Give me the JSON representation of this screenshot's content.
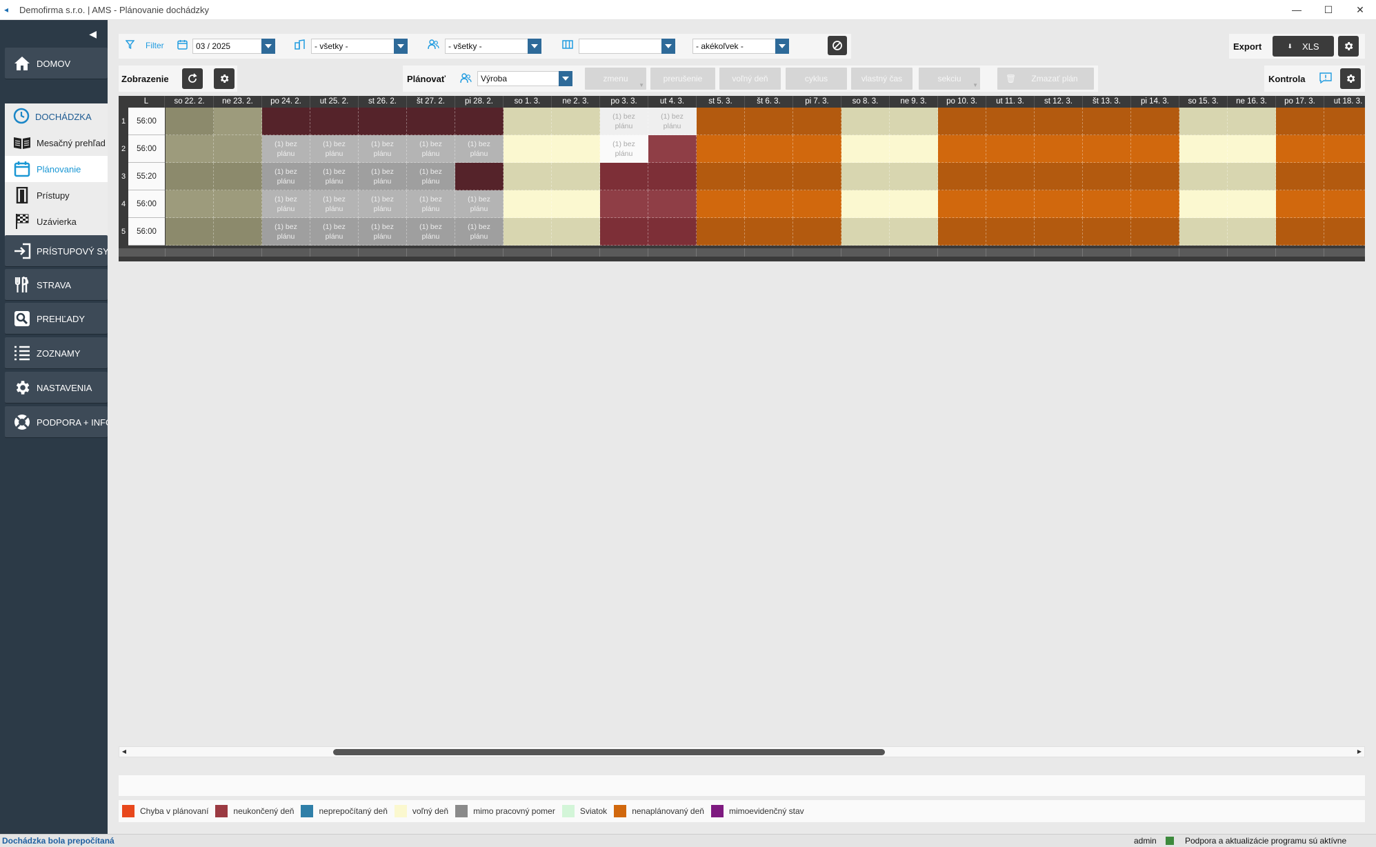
{
  "window": {
    "title": "Demofirma s.r.o. | AMS - Plánovanie dochádzky",
    "controls": [
      "—",
      "☐",
      "✕"
    ]
  },
  "sidebar": {
    "main_items": [
      {
        "label": "DOMOV",
        "icon": "home-icon"
      },
      {
        "label": "PRÍSTUPOVÝ SYSTÉM",
        "icon": "login-icon"
      },
      {
        "label": "STRAVA",
        "icon": "cutlery-icon"
      },
      {
        "label": "PREHĽADY",
        "icon": "search-icon"
      },
      {
        "label": "ZOZNAMY",
        "icon": "list-icon"
      },
      {
        "label": "NASTAVENIA",
        "icon": "gear-icon"
      },
      {
        "label": "PODPORA + INFO",
        "icon": "lifebuoy-icon"
      }
    ],
    "section": {
      "header": "DOCHÁDZKA",
      "items": [
        {
          "label": "Mesačný prehľad",
          "icon": "book-icon",
          "active": false
        },
        {
          "label": "Plánovanie",
          "icon": "calendar-icon",
          "active": true
        },
        {
          "label": "Prístupy",
          "icon": "door-icon",
          "active": false
        },
        {
          "label": "Uzávierka",
          "icon": "flag-icon",
          "active": false
        }
      ]
    }
  },
  "filter": {
    "label": "Filter",
    "month": "03 / 2025",
    "department": "- všetky -",
    "group": "- všetky -",
    "column_select": "",
    "any_select": "- akékoľvek -"
  },
  "export": {
    "label": "Export",
    "xls_label": "XLS"
  },
  "display": {
    "label": "Zobrazenie"
  },
  "plan": {
    "label": "Plánovať",
    "selected": "Výroba",
    "buttons": [
      "zmenu",
      "prerušenie",
      "voľný deň",
      "cyklus",
      "vlastný čas",
      "sekciu"
    ],
    "delete_label": "Zmazať plán"
  },
  "control": {
    "label": "Kontrola"
  },
  "grid": {
    "total_header": "L",
    "days": [
      "so 22. 2.",
      "ne 23. 2.",
      "po 24. 2.",
      "ut 25. 2.",
      "st 26. 2.",
      "št 27. 2.",
      "pi 28. 2.",
      "so 1. 3.",
      "ne 2. 3.",
      "po 3. 3.",
      "ut 4. 3.",
      "st 5. 3.",
      "št 6. 3.",
      "pi 7. 3.",
      "so 8. 3.",
      "ne 9. 3.",
      "po 10. 3.",
      "ut 11. 3.",
      "st 12. 3.",
      "št 13. 3.",
      "pi 14. 3.",
      "so 15. 3.",
      "ne 16. 3.",
      "po 17. 3.",
      "ut 18. 3."
    ],
    "rows": [
      {
        "num": "1",
        "total": "56:00"
      },
      {
        "num": "2",
        "total": "56:00"
      },
      {
        "num": "3",
        "total": "55:20"
      },
      {
        "num": "4",
        "total": "56:00"
      },
      {
        "num": "5",
        "total": "56:00"
      }
    ],
    "cell_text": "(1) bez plánu",
    "colors": {
      "A": "#8c8a6c",
      "B": "#9d9b7c",
      "D": "#55232a",
      "G": "#9f9f9f",
      "Gs": "#b4b4b4",
      "Y": "#d8d6b0",
      "Yl": "#fbf8d0",
      "R": "#7d2f37",
      "Rl": "#8f3e46",
      "W": "#efefef",
      "Ww": "#fafafa",
      "O": "#b35a0f",
      "Ol": "#d1680d"
    },
    "cells": [
      [
        "A",
        "B",
        "D",
        "D",
        "D",
        "D",
        "D",
        "Y",
        "Y",
        "Wg",
        "Wg",
        "O",
        "O",
        "O",
        "Y",
        "Y",
        "O",
        "O",
        "O",
        "O",
        "O",
        "Y",
        "Y",
        "O",
        "O"
      ],
      [
        "B",
        "B",
        "Gt",
        "Gt",
        "Gt",
        "Gt",
        "Gt",
        "Yl",
        "Yl",
        "Wt",
        "Rl",
        "Ol",
        "Ol",
        "Ol",
        "Yl",
        "Yl",
        "Ol",
        "Ol",
        "Ol",
        "Ol",
        "Ol",
        "Yl",
        "Yl",
        "Ol",
        "Ol"
      ],
      [
        "A",
        "A",
        "Gt",
        "Gt",
        "Gt",
        "Gt",
        "D",
        "Y",
        "Y",
        "R",
        "R",
        "O",
        "O",
        "O",
        "Y",
        "Y",
        "O",
        "O",
        "O",
        "O",
        "O",
        "Y",
        "Y",
        "O",
        "O"
      ],
      [
        "B",
        "B",
        "Gt",
        "Gt",
        "Gt",
        "Gt",
        "Gt",
        "Yl",
        "Yl",
        "Rl",
        "Rl",
        "Ol",
        "Ol",
        "Ol",
        "Yl",
        "Yl",
        "Ol",
        "Ol",
        "Ol",
        "Ol",
        "Ol",
        "Yl",
        "Yl",
        "Ol",
        "Ol"
      ],
      [
        "A",
        "A",
        "Gt",
        "Gt",
        "Gt",
        "Gt",
        "Gt",
        "Y",
        "Y",
        "R",
        "R",
        "O",
        "O",
        "O",
        "Y",
        "Y",
        "O",
        "O",
        "O",
        "O",
        "O",
        "Y",
        "Y",
        "O",
        "O"
      ]
    ]
  },
  "legend": [
    {
      "label": "Chyba v plánovaní",
      "color": "#e8481c"
    },
    {
      "label": "neukončený deň",
      "color": "#9b3a42"
    },
    {
      "label": "neprepočítaný deň",
      "color": "#2f7fa8"
    },
    {
      "label": "voľný deň",
      "color": "#fbf8cf"
    },
    {
      "label": "mimo pracovný pomer",
      "color": "#8a8a8a"
    },
    {
      "label": "Sviatok",
      "color": "#d3f5d8"
    },
    {
      "label": "nenaplánovaný deň",
      "color": "#d1680d"
    },
    {
      "label": "mimoevidenčný stav",
      "color": "#7e1a80"
    }
  ],
  "status": {
    "left": "Dochádzka bola prepočítaná",
    "user": "admin",
    "support": "Podpora a aktualizácie programu sú aktívne"
  }
}
